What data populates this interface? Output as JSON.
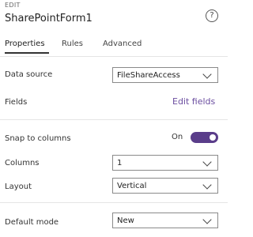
{
  "header": {
    "edit_label": "EDIT",
    "title": "SharePointForm1",
    "help_icon": "?"
  },
  "tabs": [
    {
      "label": "Properties",
      "active": true
    },
    {
      "label": "Rules",
      "active": false
    },
    {
      "label": "Advanced",
      "active": false
    }
  ],
  "properties": {
    "data_source": {
      "label": "Data source",
      "value": "FileShareAccess"
    },
    "fields": {
      "label": "Fields",
      "link": "Edit fields"
    },
    "snap_to_columns": {
      "label": "Snap to columns",
      "state": "On",
      "on": true
    },
    "columns": {
      "label": "Columns",
      "value": "1"
    },
    "layout": {
      "label": "Layout",
      "value": "Vertical"
    },
    "default_mode": {
      "label": "Default mode",
      "value": "New"
    }
  },
  "colors": {
    "accent": "#5a3d8a",
    "link": "#6b4ea0"
  }
}
